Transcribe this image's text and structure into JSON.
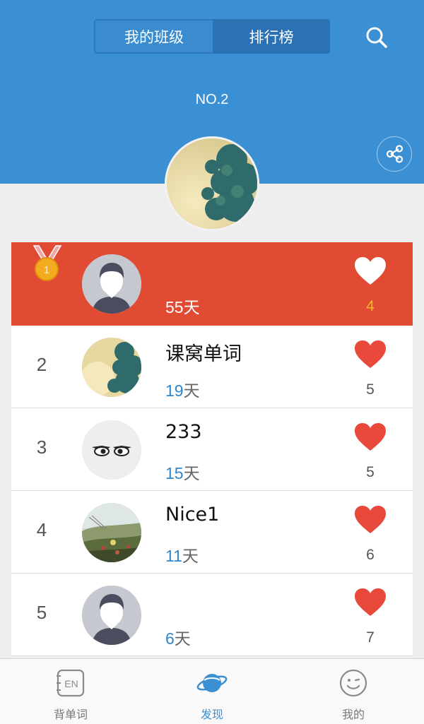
{
  "header": {
    "tabs": [
      {
        "label": "我的班级",
        "active": false
      },
      {
        "label": "排行榜",
        "active": true
      }
    ],
    "rank_label": "NO.2",
    "search_icon": "search-icon",
    "share_icon": "share-icon"
  },
  "colors": {
    "header_bg": "#3b8fd3",
    "highlight_row": "#e14b33",
    "heart": "#e8493a",
    "days_number": "#2f86c9",
    "active_tab": "#3b8fd3"
  },
  "ranking": [
    {
      "rank": "1",
      "medal": "gold-medal-icon",
      "name": "",
      "days_num": "55",
      "days_unit": "天",
      "likes": "4",
      "avatar": "default-avatar",
      "highlight": true
    },
    {
      "rank": "2",
      "name": "课窝单词",
      "days_num": "19",
      "days_unit": "天",
      "likes": "5",
      "avatar": "tree-photo-avatar"
    },
    {
      "rank": "3",
      "name": "233",
      "days_num": "15",
      "days_unit": "天",
      "likes": "5",
      "avatar": "eyes-avatar"
    },
    {
      "rank": "4",
      "name": "Nice1",
      "days_num": "11",
      "days_unit": "天",
      "likes": "6",
      "avatar": "landscape-photo-avatar"
    },
    {
      "rank": "5",
      "name": "",
      "days_num": "6",
      "days_unit": "天",
      "likes": "7",
      "avatar": "default-avatar"
    }
  ],
  "tabbar": {
    "items": [
      {
        "label": "背单词",
        "icon": "en-book-icon",
        "active": false
      },
      {
        "label": "发现",
        "icon": "planet-icon",
        "active": true
      },
      {
        "label": "我的",
        "icon": "smiley-icon",
        "active": false
      }
    ]
  }
}
